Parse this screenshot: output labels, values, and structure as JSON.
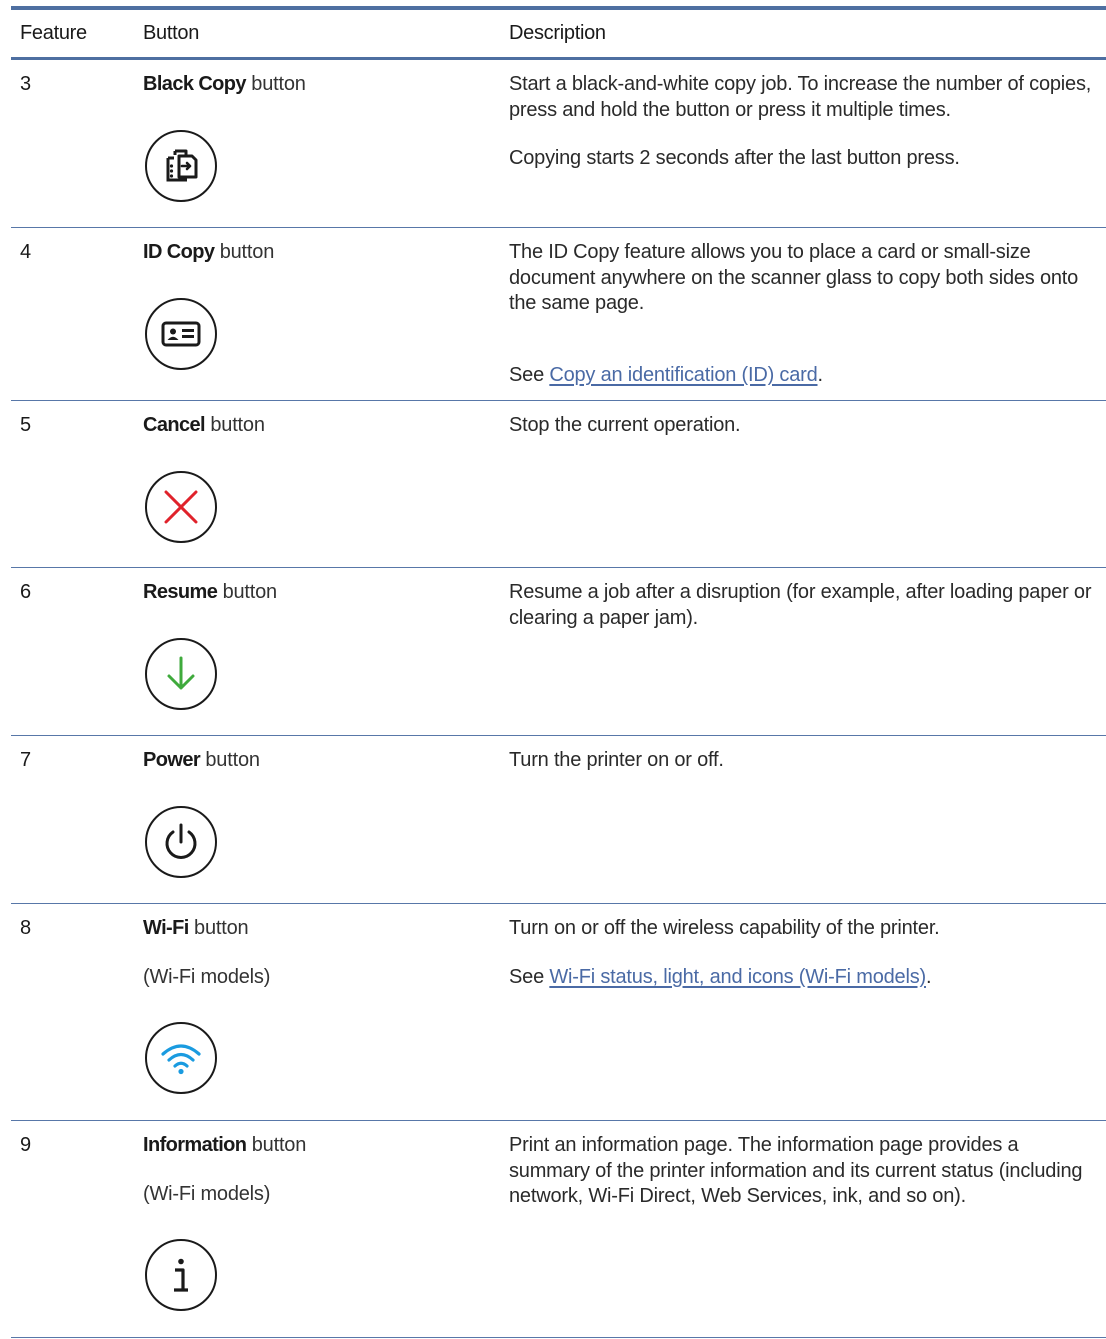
{
  "header": {
    "feature": "Feature",
    "button": "Button",
    "description": "Description"
  },
  "rows": [
    {
      "feature": "3",
      "name": "Black Copy",
      "suffix": " button",
      "icon": "black-copy-icon",
      "desc": [
        "Start a black-and-white copy job. To increase the number of copies, press and hold the button or press it multiple times.",
        "Copying starts 2 seconds after the last button press."
      ]
    },
    {
      "feature": "4",
      "name": "ID Copy",
      "suffix": " button",
      "icon": "id-card-icon",
      "desc": [
        "The ID Copy feature allows you to place a card or small-size document anywhere on the scanner glass to copy both sides onto the same page."
      ],
      "see_prefix": "See ",
      "see_link": "Copy an identification (ID) card",
      "see_suffix": "."
    },
    {
      "feature": "5",
      "name": "Cancel",
      "suffix": " button",
      "icon": "close-icon",
      "desc": [
        "Stop the current operation."
      ]
    },
    {
      "feature": "6",
      "name": "Resume",
      "suffix": " button",
      "icon": "arrow-down-icon",
      "desc": [
        "Resume a job after a disruption (for example, after loading paper or clearing a paper jam)."
      ]
    },
    {
      "feature": "7",
      "name": "Power",
      "suffix": " button",
      "icon": "power-icon",
      "desc": [
        "Turn the printer on or off."
      ]
    },
    {
      "feature": "8",
      "name": "Wi-Fi",
      "suffix": " button",
      "sub": "(Wi-Fi models)",
      "icon": "wifi-icon",
      "desc": [
        "Turn on or off the wireless capability of the printer."
      ],
      "see_prefix": "See ",
      "see_link": "Wi-Fi status, light, and icons (Wi-Fi models)",
      "see_suffix": "."
    },
    {
      "feature": "9",
      "name": "Information",
      "suffix": " button",
      "sub": "(Wi-Fi models)",
      "icon": "info-icon",
      "desc": [
        "Print an information page. The information page provides a summary of the printer information and its current status (including network, Wi-Fi Direct, Web Services, ink, and so on)."
      ]
    }
  ],
  "colors": {
    "rule": "#4e6fa1",
    "link": "#4a6aa5",
    "cancel_red": "#e0222b",
    "resume_green": "#3faa3c",
    "wifi_blue": "#1a9be0"
  }
}
